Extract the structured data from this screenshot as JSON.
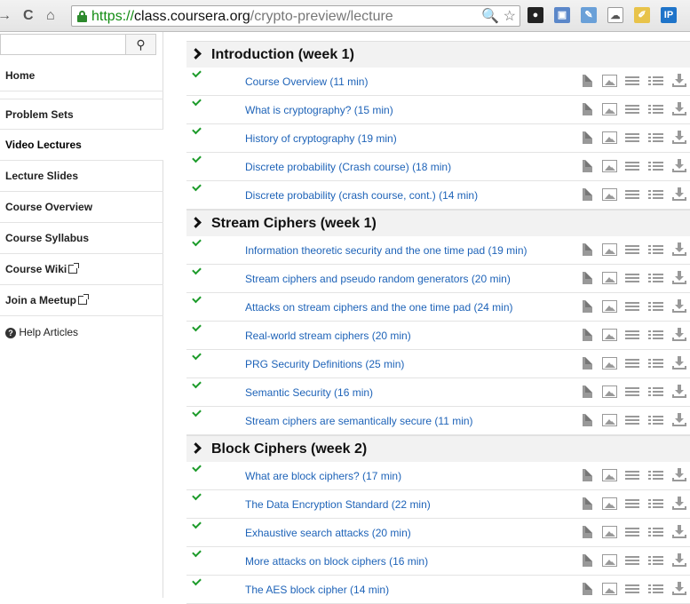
{
  "browser": {
    "url_scheme": "https://",
    "url_host": "class.coursera.org",
    "url_path": "/crypto-preview/lecture",
    "extensions": [
      {
        "name": "spy-icon",
        "glyph": "🕶"
      },
      {
        "name": "screenshot-icon",
        "glyph": "▣"
      },
      {
        "name": "feather-icon",
        "glyph": "✎"
      },
      {
        "name": "cloud-icon",
        "glyph": "☁"
      },
      {
        "name": "note-icon",
        "glyph": "✐"
      },
      {
        "name": "ip-icon",
        "glyph": "IP"
      }
    ]
  },
  "sidebar": {
    "search_button_glyph": "🔍",
    "items": [
      {
        "label": "Home"
      },
      {
        "label": "Problem Sets"
      },
      {
        "label": "Video Lectures"
      },
      {
        "label": "Lecture Slides"
      },
      {
        "label": "Course Overview"
      },
      {
        "label": "Course Syllabus"
      },
      {
        "label": "Course Wiki"
      },
      {
        "label": "Join a Meetup"
      }
    ],
    "help_label": "Help Articles"
  },
  "sections": [
    {
      "title": "Introduction (week 1)",
      "lectures": [
        "Course Overview (11 min)",
        "What is cryptography? (15 min)",
        "History of cryptography (19 min)",
        "Discrete probability (Crash course) (18 min)",
        "Discrete probability (crash course, cont.) (14 min)"
      ]
    },
    {
      "title": "Stream Ciphers (week 1)",
      "lectures": [
        "Information theoretic security and the one time pad (19 min)",
        "Stream ciphers and pseudo random generators (20 min)",
        "Attacks on stream ciphers and the one time pad (24 min)",
        "Real-world stream ciphers (20 min)",
        "PRG Security Definitions (25 min)",
        "Semantic Security (16 min)",
        "Stream ciphers are semantically secure (11 min)"
      ]
    },
    {
      "title": "Block Ciphers (week 2)",
      "lectures": [
        "What are block ciphers? (17 min)",
        "The Data Encryption Standard (22 min)",
        "Exhaustive search attacks (20 min)",
        "More attacks on block ciphers (16 min)",
        "The AES block cipher (14 min)"
      ]
    }
  ],
  "colors": {
    "link": "#1e63b8",
    "check": "#1c9b2a",
    "https": "#118c11"
  }
}
